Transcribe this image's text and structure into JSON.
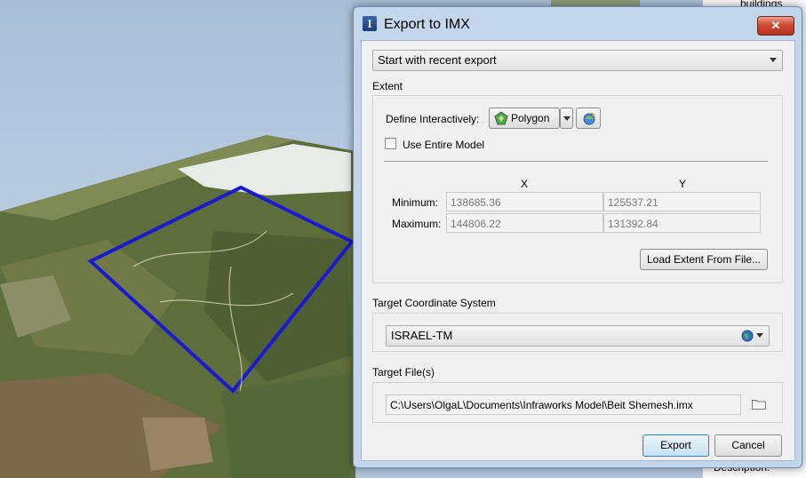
{
  "dialog": {
    "title": "Export to IMX",
    "close_label": "✕",
    "preset": {
      "selected": "Start with recent export"
    },
    "extent": {
      "section_label": "Extent",
      "define_label": "Define Interactively:",
      "polygon_label": "Polygon",
      "use_entire_model_label": "Use Entire Model",
      "use_entire_model_checked": false,
      "x_header": "X",
      "y_header": "Y",
      "minimum_label": "Minimum:",
      "maximum_label": "Maximum:",
      "min_x": "138685.36",
      "min_y": "125537.21",
      "max_x": "144806.22",
      "max_y": "131392.84",
      "load_button": "Load Extent From File..."
    },
    "coordinate_system": {
      "section_label": "Target Coordinate System",
      "selected": "ISRAEL-TM"
    },
    "target_files": {
      "section_label": "Target File(s)",
      "path": "C:\\Users\\OlgaL\\Documents\\Infraworks Model\\Beit Shemesh.imx"
    },
    "buttons": {
      "export": "Export",
      "cancel": "Cancel"
    }
  },
  "side_panel": {
    "top_text": "buildings",
    "bottom_text": "Description:"
  },
  "colors": {
    "dialog_frame": "#c4d6ec",
    "client_bg": "#f0f0f0",
    "close_red": "#cf4b33",
    "selection_outline": "#1a1ad0"
  },
  "icons": {
    "title": "infraworks-app-icon",
    "polygon": "polygon-tool-icon",
    "pick": "pick-extent-icon",
    "globe": "globe-icon",
    "folder": "folder-icon"
  }
}
